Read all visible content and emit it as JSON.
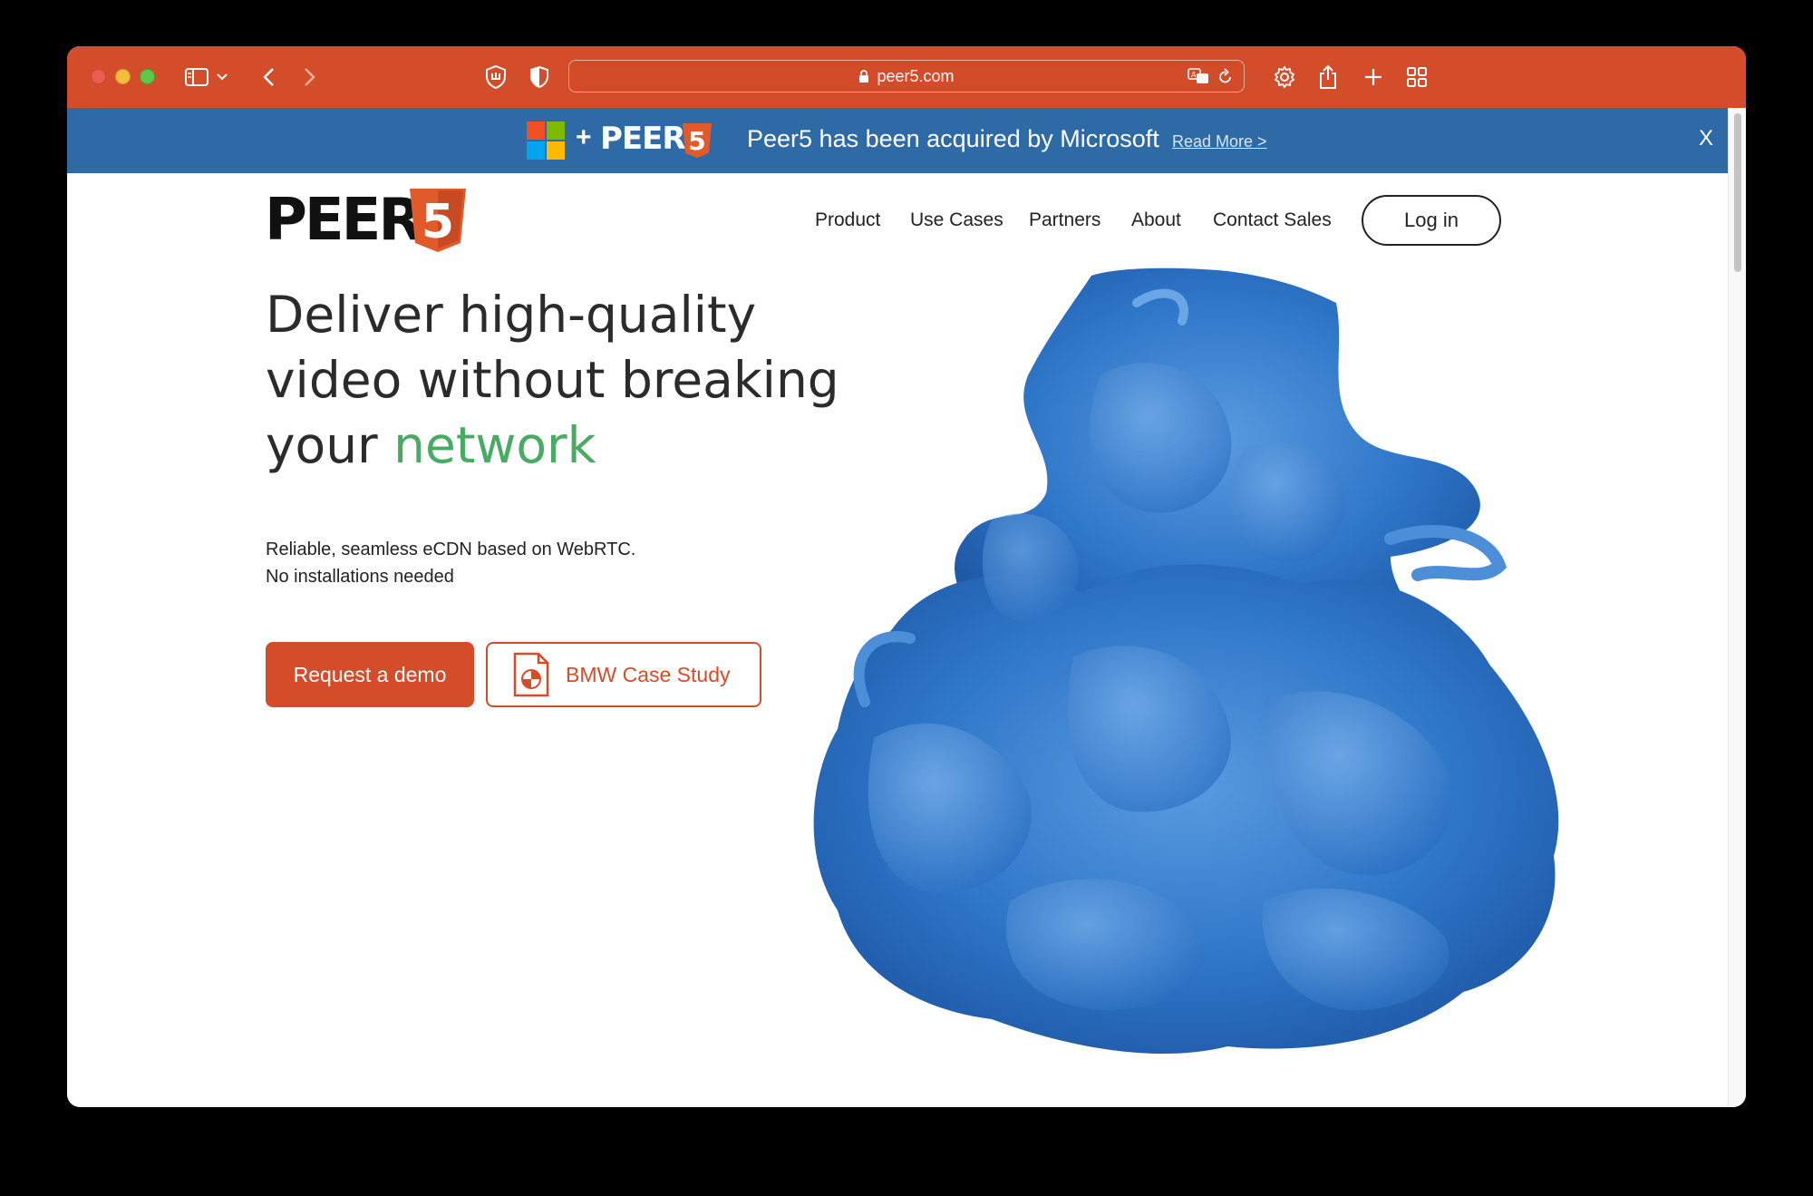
{
  "browser": {
    "url": "peer5.com",
    "icons": [
      "sidebar-icon",
      "chevron-down-icon",
      "back-icon",
      "forward-icon",
      "shield-icon",
      "privacy-icon",
      "lock-icon",
      "translate-icon",
      "reload-icon",
      "settings-icon",
      "share-icon",
      "new-tab-icon",
      "tab-overview-icon"
    ],
    "toolbar_color": "#d34d2a"
  },
  "banner": {
    "plus": "+",
    "brand": "PEER",
    "brand_five": "5",
    "message": "Peer5 has been acquired by Microsoft",
    "link": "Read More >",
    "close": "X",
    "background": "#2e6aa5"
  },
  "header": {
    "logo": "PEER",
    "logo_five": "5",
    "nav": [
      "Product",
      "Use Cases",
      "Partners",
      "About",
      "Contact Sales"
    ],
    "login": "Log in"
  },
  "hero": {
    "headline_1": "Deliver high-quality",
    "headline_2": "video without breaking",
    "headline_3": "your",
    "headline_accent": "network",
    "sub_1": "Reliable, seamless eCDN based on WebRTC.",
    "sub_2": "No installations needed",
    "primary_button": "Request a demo",
    "secondary_button": "BMW Case Study",
    "accent_color": "#48ab62",
    "brand_color": "#d34d2a"
  }
}
